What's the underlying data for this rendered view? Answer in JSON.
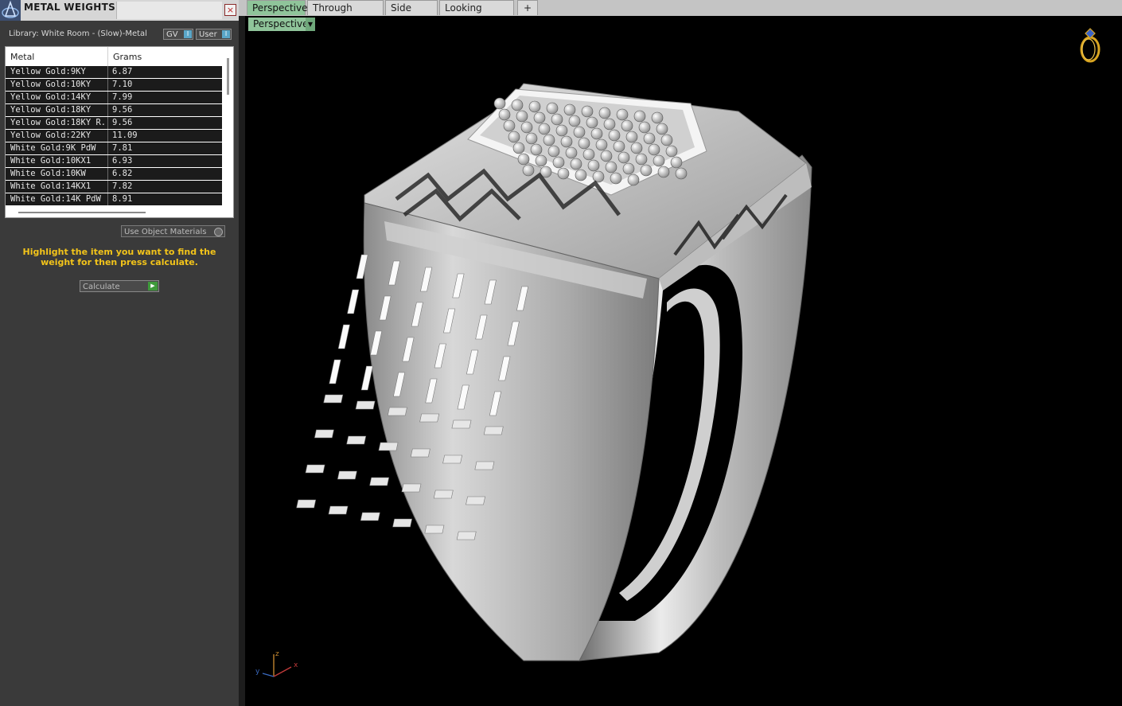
{
  "panel": {
    "title": "METAL WEIGHTS",
    "close_label": "×",
    "library_label": "Library: White Room - (Slow)-Metal",
    "toggles": [
      {
        "label": "GV",
        "state": "I"
      },
      {
        "label": "User",
        "state": "I"
      }
    ],
    "table": {
      "columns": [
        "Metal",
        "Grams"
      ],
      "rows": [
        {
          "metal": "Yellow Gold:9KY",
          "grams": "6.87"
        },
        {
          "metal": "Yellow Gold:10KY",
          "grams": "7.10"
        },
        {
          "metal": "Yellow Gold:14KY",
          "grams": "7.99"
        },
        {
          "metal": "Yellow Gold:18KY",
          "grams": "9.56"
        },
        {
          "metal": "Yellow Gold:18KY R...",
          "grams": "9.56"
        },
        {
          "metal": "Yellow Gold:22KY",
          "grams": "11.09"
        },
        {
          "metal": "White Gold:9K PdW",
          "grams": "7.81"
        },
        {
          "metal": "White Gold:10KX1",
          "grams": "6.93"
        },
        {
          "metal": "White Gold:10KW",
          "grams": "6.82"
        },
        {
          "metal": "White Gold:14KX1",
          "grams": "7.82"
        },
        {
          "metal": "White Gold:14K PdW",
          "grams": "8.91"
        }
      ]
    },
    "use_object_materials_label": "Use Object Materials",
    "hint": "Highlight the item you want to find the weight for then press calculate.",
    "calculate_label": "Calculate"
  },
  "viewport": {
    "tabs": [
      {
        "label": "Perspective",
        "active": true
      },
      {
        "label": "Through Finger",
        "active": false
      },
      {
        "label": "Side View",
        "active": false
      },
      {
        "label": "Looking Down",
        "active": false
      }
    ],
    "add_tab_label": "+",
    "view_dropdown": "Perspective",
    "axes": {
      "x": "x",
      "y": "y",
      "z": "z"
    }
  },
  "colors": {
    "hint_yellow": "#f3c41a",
    "active_tab_green": "#8fc49a",
    "viewport_bg": "#000000",
    "panel_bg": "#3a3a3a"
  },
  "icons": [
    "app-logo-icon",
    "close-icon",
    "chevron-down-icon",
    "play-icon",
    "ring-icon",
    "axis-gizmo-icon"
  ]
}
